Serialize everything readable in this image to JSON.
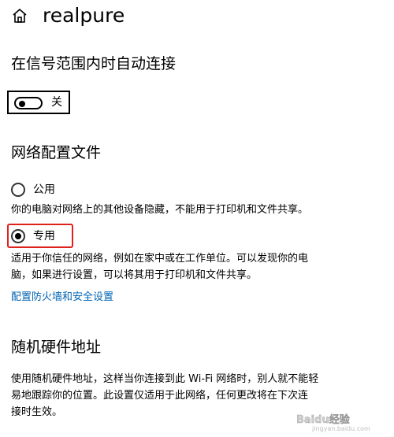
{
  "header": {
    "title": "realpure",
    "icon": "home-icon"
  },
  "auto_connect": {
    "title": "在信号范围内时自动连接",
    "toggle_state": "关",
    "toggle_on": false
  },
  "network_profile": {
    "title": "网络配置文件",
    "options": [
      {
        "label": "公用",
        "checked": false,
        "description": "你的电脑对网络上的其他设备隐藏，不能用于打印机和文件共享。"
      },
      {
        "label": "专用",
        "checked": true,
        "description_line1": "适用于你信任的网络，例如在家中或在工作单位。可以发现你的电",
        "description_line2": "脑，如果进行设置，可以将其用于打印机和文件共享。"
      }
    ],
    "firewall_link": "配置防火墙和安全设置"
  },
  "random_hw": {
    "title": "随机硬件地址",
    "description_line1": "使用随机硬件地址，这样当你连接到此 Wi-Fi 网络时，别人就不能轻",
    "description_line2": "易地跟踪你的位置。此设置仅适用于此网络，任何更改将在下次连",
    "description_line3": "接时生效。"
  },
  "watermark": {
    "brand": "Baidu经验",
    "url": "jingyan.baidu.com"
  },
  "colors": {
    "link": "#0063b1",
    "highlight": "#e0201b"
  }
}
